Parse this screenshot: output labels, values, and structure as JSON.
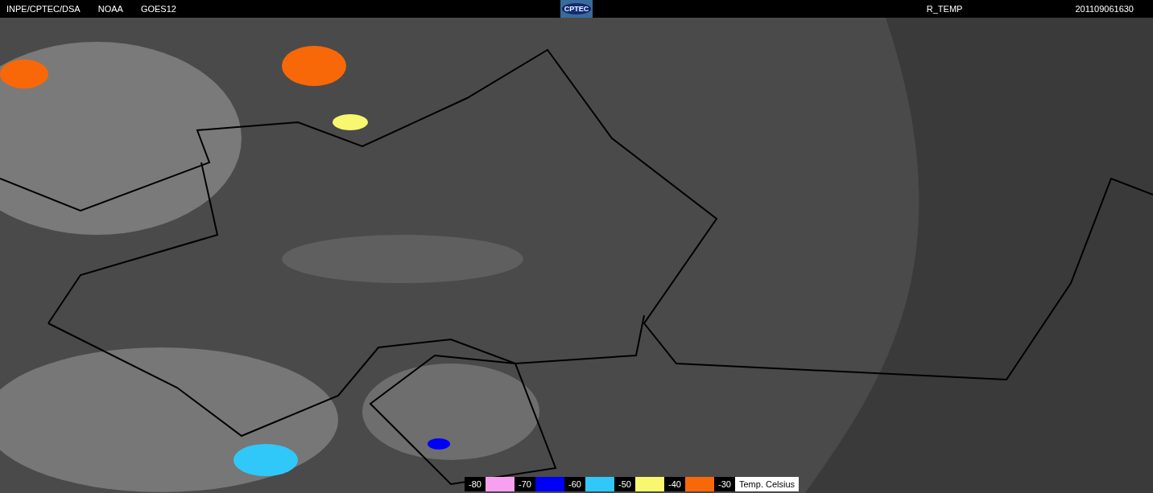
{
  "header": {
    "left": [
      "INPE/CPTEC/DSA",
      "NOAA",
      "GOES12"
    ],
    "logo": "CPTEC",
    "product": "R_TEMP",
    "timestamp": "201109061630"
  },
  "legend": {
    "steps": [
      {
        "label": "-80",
        "color": "#f8a0f0"
      },
      {
        "label": "-70",
        "color": "#0000f8"
      },
      {
        "label": "-60",
        "color": "#30c8f8"
      },
      {
        "label": "-50",
        "color": "#f8f870"
      },
      {
        "label": "-40",
        "color": "#f86808"
      },
      {
        "label": "-30"
      }
    ],
    "caption": "Temp. Celsius"
  }
}
